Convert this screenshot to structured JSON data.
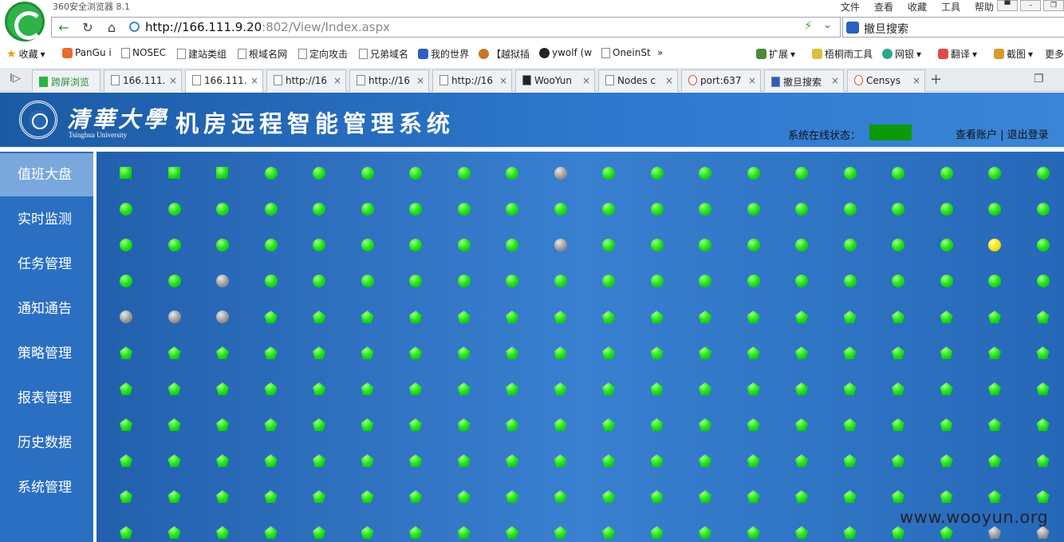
{
  "browser": {
    "name": "360安全浏览器 8.1",
    "menu": [
      "文件",
      "查看",
      "收藏",
      "工具",
      "帮助"
    ],
    "window_controls": [
      "pin",
      "minimize",
      "maximize"
    ],
    "url_host": "http://166.111.9.20",
    "url_rest": ":802/View/Index.aspx",
    "search_engine_text": "撤旦搜索"
  },
  "bookmarks": {
    "items": [
      "收藏",
      "PanGu i",
      "NOSEC",
      "建站类组",
      "根域名网",
      "定向攻击",
      "兄弟域名",
      "我的世界",
      "【越狱插",
      "ywolf (w",
      "OneinSt"
    ],
    "more": "»",
    "tools": [
      "扩展",
      "梧桐雨工具",
      "网银",
      "翻译",
      "截图",
      "更多"
    ]
  },
  "tabs": {
    "items": [
      "跨屏浏览",
      "166.111.",
      "166.111.",
      "http://16",
      "http://16",
      "http://16",
      "WooYun",
      "Nodes c",
      "port:637",
      "撤旦搜索",
      "Censys"
    ],
    "active_index": 2,
    "new_tab": "+"
  },
  "app": {
    "university_cn": "清華大學",
    "university_en": "Tsinghua University",
    "title": "机房远程智能管理系统",
    "status_label": "系统在线状态：",
    "status_color": "#0a9a0a",
    "account_links": "查看账户 | 退出登录"
  },
  "sidebar": {
    "items": [
      "值班大盘",
      "实时监测",
      "任务管理",
      "通知通告",
      "策略管理",
      "报表管理",
      "历史数据",
      "系统管理"
    ],
    "active_index": 0
  },
  "grid": {
    "rows": [
      [
        "square-green",
        "square-green",
        "square-green",
        "circle-green",
        "circle-green",
        "circle-green",
        "circle-green",
        "circle-green",
        "circle-green",
        "circle-gray",
        "circle-green",
        "circle-green",
        "circle-green",
        "circle-green",
        "circle-green",
        "circle-green",
        "circle-green",
        "circle-green",
        "circle-green",
        "circle-green"
      ],
      [
        "circle-green",
        "circle-green",
        "circle-green",
        "circle-green",
        "circle-green",
        "circle-green",
        "circle-green",
        "circle-green",
        "circle-green",
        "circle-green",
        "circle-green",
        "circle-green",
        "circle-green",
        "circle-green",
        "circle-green",
        "circle-green",
        "circle-green",
        "circle-green",
        "circle-green",
        "circle-green"
      ],
      [
        "circle-green",
        "circle-green",
        "circle-green",
        "circle-green",
        "circle-green",
        "circle-green",
        "circle-green",
        "circle-green",
        "circle-green",
        "circle-gray",
        "circle-green",
        "circle-green",
        "circle-green",
        "circle-green",
        "circle-green",
        "circle-green",
        "circle-green",
        "circle-green",
        "circle-yellow",
        "circle-green"
      ],
      [
        "circle-green",
        "circle-green",
        "circle-gray",
        "circle-green",
        "circle-green",
        "circle-green",
        "circle-green",
        "circle-green",
        "circle-green",
        "circle-green",
        "circle-green",
        "circle-green",
        "circle-green",
        "circle-green",
        "circle-green",
        "circle-green",
        "circle-green",
        "circle-green",
        "circle-green",
        "circle-green"
      ],
      [
        "circle-gray",
        "circle-gray",
        "circle-gray",
        "pentagon-green",
        "pentagon-green",
        "pentagon-green",
        "pentagon-green",
        "pentagon-green",
        "pentagon-green",
        "pentagon-green",
        "pentagon-green",
        "pentagon-green",
        "pentagon-green",
        "pentagon-green",
        "pentagon-green",
        "pentagon-green",
        "pentagon-green",
        "pentagon-green",
        "pentagon-green",
        "pentagon-green"
      ],
      [
        "pentagon-green",
        "pentagon-green",
        "pentagon-green",
        "pentagon-green",
        "pentagon-green",
        "pentagon-green",
        "pentagon-green",
        "pentagon-green",
        "pentagon-green",
        "pentagon-green",
        "pentagon-green",
        "pentagon-green",
        "pentagon-green",
        "pentagon-green",
        "pentagon-green",
        "pentagon-green",
        "pentagon-green",
        "pentagon-green",
        "pentagon-green",
        "pentagon-green"
      ],
      [
        "pentagon-green",
        "pentagon-green",
        "pentagon-green",
        "pentagon-green",
        "pentagon-green",
        "pentagon-green",
        "pentagon-green",
        "pentagon-green",
        "pentagon-green",
        "pentagon-green",
        "pentagon-green",
        "pentagon-green",
        "pentagon-green",
        "pentagon-green",
        "pentagon-green",
        "pentagon-green",
        "pentagon-green",
        "pentagon-green",
        "pentagon-green",
        "pentagon-green"
      ],
      [
        "pentagon-green",
        "pentagon-green",
        "pentagon-green",
        "pentagon-green",
        "pentagon-green",
        "pentagon-green",
        "pentagon-green",
        "pentagon-green",
        "pentagon-green",
        "pentagon-green",
        "pentagon-green",
        "pentagon-green",
        "pentagon-green",
        "pentagon-green",
        "pentagon-green",
        "pentagon-green",
        "pentagon-green",
        "pentagon-green",
        "pentagon-green",
        "pentagon-green"
      ],
      [
        "pentagon-green",
        "pentagon-green",
        "pentagon-green",
        "pentagon-green",
        "pentagon-green",
        "pentagon-green",
        "pentagon-green",
        "pentagon-green",
        "pentagon-green",
        "pentagon-green",
        "pentagon-green",
        "pentagon-green",
        "pentagon-green",
        "pentagon-green",
        "pentagon-green",
        "pentagon-green",
        "pentagon-green",
        "pentagon-green",
        "pentagon-green",
        "pentagon-green"
      ],
      [
        "pentagon-green",
        "pentagon-green",
        "pentagon-green",
        "pentagon-green",
        "pentagon-green",
        "pentagon-green",
        "pentagon-green",
        "pentagon-green",
        "pentagon-green",
        "pentagon-green",
        "pentagon-green",
        "pentagon-green",
        "pentagon-green",
        "pentagon-green",
        "pentagon-green",
        "pentagon-green",
        "pentagon-green",
        "pentagon-green",
        "pentagon-green",
        "pentagon-green"
      ],
      [
        "pentagon-green",
        "pentagon-green",
        "pentagon-green",
        "pentagon-green",
        "pentagon-green",
        "pentagon-green",
        "pentagon-green",
        "pentagon-green",
        "pentagon-green",
        "pentagon-green",
        "pentagon-green",
        "pentagon-green",
        "pentagon-green",
        "pentagon-green",
        "pentagon-green",
        "pentagon-green",
        "pentagon-green",
        "pentagon-green",
        "pentagon-gray",
        "pentagon-gray"
      ]
    ]
  },
  "watermark": "www.wooyun.org"
}
